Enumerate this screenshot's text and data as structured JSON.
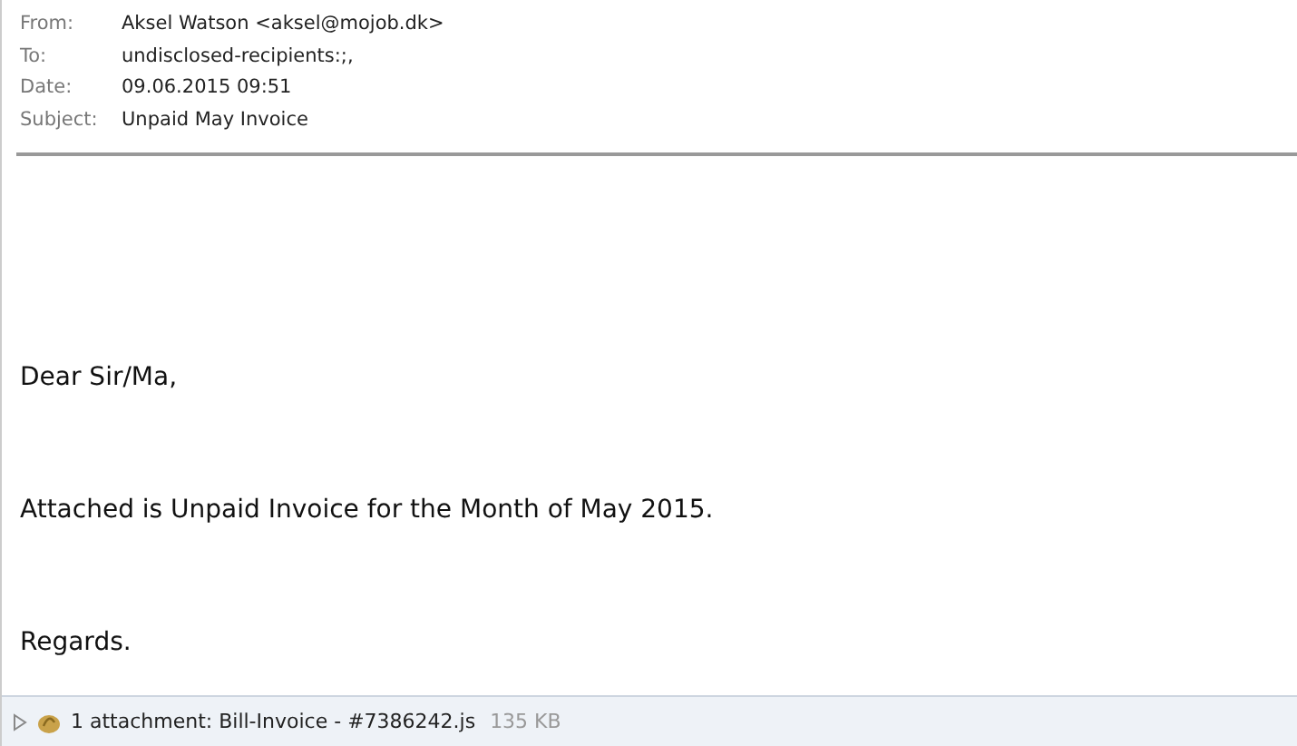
{
  "header": [
    {
      "label": "From:",
      "value": "Aksel Watson <aksel@mojob.dk>"
    },
    {
      "label": "To:",
      "value": "undisclosed-recipients:;,"
    },
    {
      "label": "Date:",
      "value": "09.06.2015 09:51"
    },
    {
      "label": "Subject:",
      "value": "Unpaid May Invoice"
    }
  ],
  "body": [
    "Dear Sir/Ma,",
    "Attached is Unpaid Invoice for the Month of May 2015.",
    "Regards."
  ],
  "attachment_bar": {
    "expanded": false,
    "summary": "1 attachment: Bill-Invoice - #7386242.js",
    "size": "135 KB"
  }
}
